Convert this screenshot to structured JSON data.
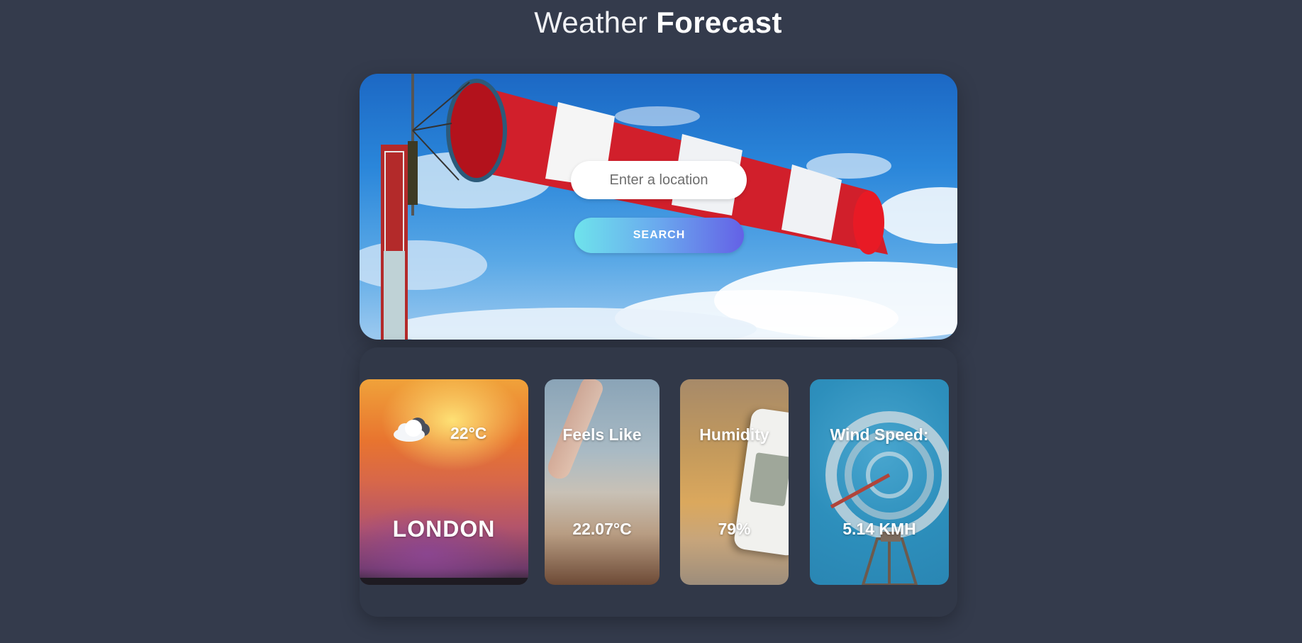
{
  "header": {
    "title_light": "Weather",
    "title_bold": "Forecast"
  },
  "search": {
    "placeholder": "Enter a location",
    "value": "",
    "button_label": "SEARCH"
  },
  "current": {
    "icon": "cloud-icon",
    "temperature": "22°C",
    "city": "LONDON"
  },
  "stats": {
    "feels_like": {
      "label": "Feels Like",
      "value": "22.07°C"
    },
    "humidity": {
      "label": "Humidity",
      "value": "79%"
    },
    "wind_speed": {
      "label": "Wind Speed:",
      "value": "5.14 KMH"
    }
  },
  "colors": {
    "background": "#343b4c",
    "panel": "#313848",
    "button_gradient_start": "#6ee3ec",
    "button_gradient_end": "#6461e6"
  }
}
